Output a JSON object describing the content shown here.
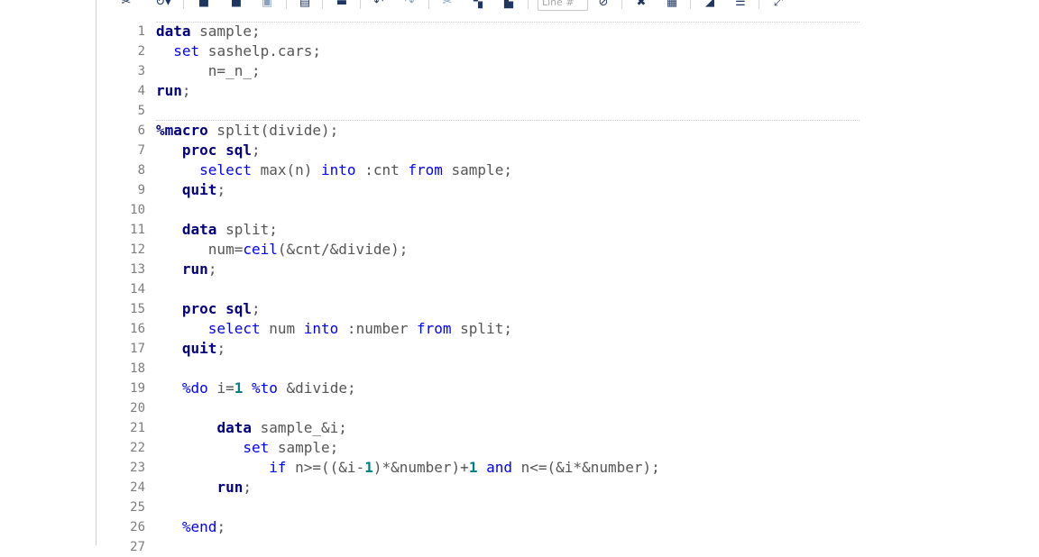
{
  "toolbar": {
    "line_input_placeholder": "Line #",
    "icons": [
      "run-icon",
      "undo-dropdown-icon",
      "save-icon",
      "save-as-icon",
      "open-icon",
      "log-icon",
      "export-icon",
      "undo-icon",
      "redo-icon",
      "cut-icon",
      "copy-icon",
      "paste-icon",
      "goto-line-icon",
      "clear-icon",
      "format-code-icon",
      "highlight-icon",
      "properties-icon",
      "maximize-icon"
    ]
  },
  "editor": {
    "lines": [
      [
        {
          "t": "data",
          "c": "kw"
        },
        {
          "t": " sample;"
        }
      ],
      [
        {
          "t": "  "
        },
        {
          "t": "set",
          "c": "fn"
        },
        {
          "t": " sashelp.cars;"
        }
      ],
      [
        {
          "t": "      n=_n_;"
        }
      ],
      [
        {
          "t": "run",
          "c": "kw"
        },
        {
          "t": ";"
        }
      ],
      [
        {
          "t": ""
        }
      ],
      [
        {
          "t": "%macro",
          "c": "kw"
        },
        {
          "t": " split(divide);"
        }
      ],
      [
        {
          "t": "   "
        },
        {
          "t": "proc sql",
          "c": "kw"
        },
        {
          "t": ";"
        }
      ],
      [
        {
          "t": "     "
        },
        {
          "t": "select",
          "c": "fn"
        },
        {
          "t": " max(n) "
        },
        {
          "t": "into",
          "c": "fn"
        },
        {
          "t": " :cnt "
        },
        {
          "t": "from",
          "c": "fn"
        },
        {
          "t": " sample;"
        }
      ],
      [
        {
          "t": "   "
        },
        {
          "t": "quit",
          "c": "kw"
        },
        {
          "t": ";"
        }
      ],
      [
        {
          "t": ""
        }
      ],
      [
        {
          "t": "   "
        },
        {
          "t": "data",
          "c": "kw"
        },
        {
          "t": " split;"
        }
      ],
      [
        {
          "t": "      num="
        },
        {
          "t": "ceil",
          "c": "fn"
        },
        {
          "t": "(&cnt/&divide);"
        }
      ],
      [
        {
          "t": "   "
        },
        {
          "t": "run",
          "c": "kw"
        },
        {
          "t": ";"
        }
      ],
      [
        {
          "t": ""
        }
      ],
      [
        {
          "t": "   "
        },
        {
          "t": "proc sql",
          "c": "kw"
        },
        {
          "t": ";"
        }
      ],
      [
        {
          "t": "      "
        },
        {
          "t": "select",
          "c": "fn"
        },
        {
          "t": " num "
        },
        {
          "t": "into",
          "c": "fn"
        },
        {
          "t": " :number "
        },
        {
          "t": "from",
          "c": "fn"
        },
        {
          "t": " split;"
        }
      ],
      [
        {
          "t": "   "
        },
        {
          "t": "quit",
          "c": "kw"
        },
        {
          "t": ";"
        }
      ],
      [
        {
          "t": ""
        }
      ],
      [
        {
          "t": "   "
        },
        {
          "t": "%do",
          "c": "fn"
        },
        {
          "t": " i="
        },
        {
          "t": "1",
          "c": "num"
        },
        {
          "t": " "
        },
        {
          "t": "%to",
          "c": "fn"
        },
        {
          "t": " &divide;"
        }
      ],
      [
        {
          "t": ""
        }
      ],
      [
        {
          "t": "       "
        },
        {
          "t": "data",
          "c": "kw"
        },
        {
          "t": " sample_&i;"
        }
      ],
      [
        {
          "t": "          "
        },
        {
          "t": "set",
          "c": "fn"
        },
        {
          "t": " sample;"
        }
      ],
      [
        {
          "t": "             "
        },
        {
          "t": "if",
          "c": "fn"
        },
        {
          "t": " n>=((&i-"
        },
        {
          "t": "1",
          "c": "num"
        },
        {
          "t": ")*&number)+"
        },
        {
          "t": "1",
          "c": "num"
        },
        {
          "t": " "
        },
        {
          "t": "and",
          "c": "fn"
        },
        {
          "t": " n<=(&i*&number);"
        }
      ],
      [
        {
          "t": "       "
        },
        {
          "t": "run",
          "c": "kw"
        },
        {
          "t": ";"
        }
      ],
      [
        {
          "t": ""
        }
      ],
      [
        {
          "t": "   "
        },
        {
          "t": "%end",
          "c": "fn"
        },
        {
          "t": ";"
        }
      ],
      [
        {
          "t": ""
        }
      ]
    ]
  }
}
